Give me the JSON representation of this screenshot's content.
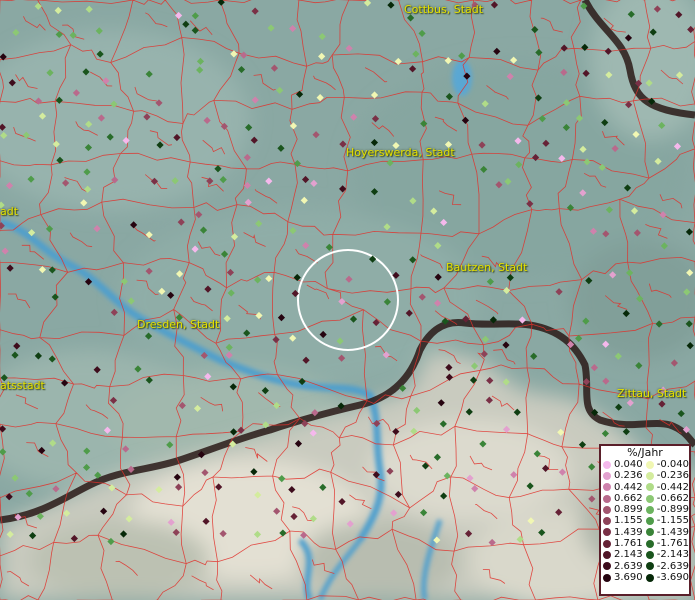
{
  "map": {
    "cities": [
      {
        "name": "Cottbus, Stadt"
      },
      {
        "name": "Hoyerswerda, Stadt"
      },
      {
        "name": "Bautzen, Stadt"
      },
      {
        "name": "Dresden, Stadt"
      },
      {
        "name": "Zittau, Stadt"
      },
      {
        "name": "atsstadt"
      },
      {
        "name": "adt"
      }
    ],
    "legend": {
      "title": "%/Jahr",
      "positive": [
        {
          "label": "0.040",
          "color": "#f5b8ec"
        },
        {
          "label": "0.236",
          "color": "#e3a1cf"
        },
        {
          "label": "0.442",
          "color": "#cf82ac"
        },
        {
          "label": "0.662",
          "color": "#b96a8c"
        },
        {
          "label": "0.899",
          "color": "#a3566f"
        },
        {
          "label": "1.155",
          "color": "#8e4258"
        },
        {
          "label": "1.439",
          "color": "#7a3046"
        },
        {
          "label": "1.761",
          "color": "#662236"
        },
        {
          "label": "2.143",
          "color": "#521628"
        },
        {
          "label": "2.639",
          "color": "#3e0c1c"
        },
        {
          "label": "3.690",
          "color": "#260410"
        }
      ],
      "negative": [
        {
          "label": "-0.040",
          "color": "#f1f7b3"
        },
        {
          "label": "-0.236",
          "color": "#d4ec9e"
        },
        {
          "label": "-0.442",
          "color": "#b0dc88"
        },
        {
          "label": "-0.662",
          "color": "#8cc874"
        },
        {
          "label": "-0.899",
          "color": "#6cb35f"
        },
        {
          "label": "-1.155",
          "color": "#4f9c4a"
        },
        {
          "label": "-1.439",
          "color": "#3a8438"
        },
        {
          "label": "-1.761",
          "color": "#286c2a"
        },
        {
          "label": "-2.143",
          "color": "#1a551d"
        },
        {
          "label": "-2.639",
          "color": "#0f3e12"
        },
        {
          "label": "-3.690",
          "color": "#062808"
        }
      ]
    }
  }
}
